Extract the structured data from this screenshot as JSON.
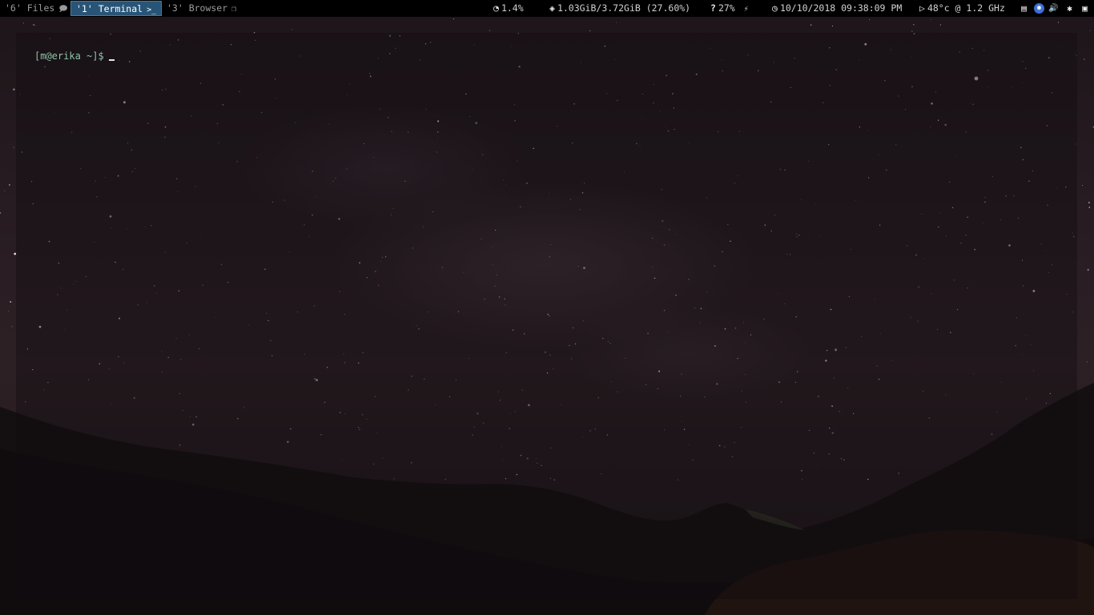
{
  "workspaces": [
    {
      "label": "'6' Files",
      "icon": "message-icon",
      "glyph": "🗩",
      "focused": false
    },
    {
      "label": "'1' Terminal",
      "icon": "terminal-icon",
      "glyph": ">_",
      "focused": true
    },
    {
      "label": "'3' Browser",
      "icon": "windows-icon",
      "glyph": "❐",
      "focused": false
    }
  ],
  "status": {
    "cpu": {
      "icon": "speedometer-icon",
      "glyph": "◔",
      "value": "1.4%"
    },
    "memory": {
      "icon": "ram-icon",
      "glyph": "◈",
      "value": "1.03GiB/3.72GiB (27.60%)"
    },
    "battery": {
      "icon": "unknown-battery-icon",
      "glyph": "?",
      "value": "27%",
      "plug_icon": "plug-icon",
      "plug_glyph": "⚡"
    },
    "clock": {
      "icon": "clock-icon",
      "glyph": "◷",
      "value": "10/10/2018 09:38:09 PM"
    },
    "temp": {
      "icon": "play-icon",
      "glyph": "▷",
      "value": "48°c @ 1.2 GHz"
    }
  },
  "tray": [
    {
      "name": "clipboard-icon",
      "glyph": "▤"
    },
    {
      "name": "app-indicator-icon",
      "glyph": "◉"
    },
    {
      "name": "volume-icon",
      "glyph": "🔊"
    },
    {
      "name": "settings-gear-icon",
      "glyph": "✱"
    },
    {
      "name": "window-square-icon",
      "glyph": "▣"
    }
  ],
  "terminal": {
    "prompt": "[m@erika ~]$"
  },
  "colors": {
    "bar_bg": "#000000",
    "focused_ws_bg": "#285577",
    "focused_ws_border": "#4c7899",
    "prompt": "#8dc2a8"
  }
}
